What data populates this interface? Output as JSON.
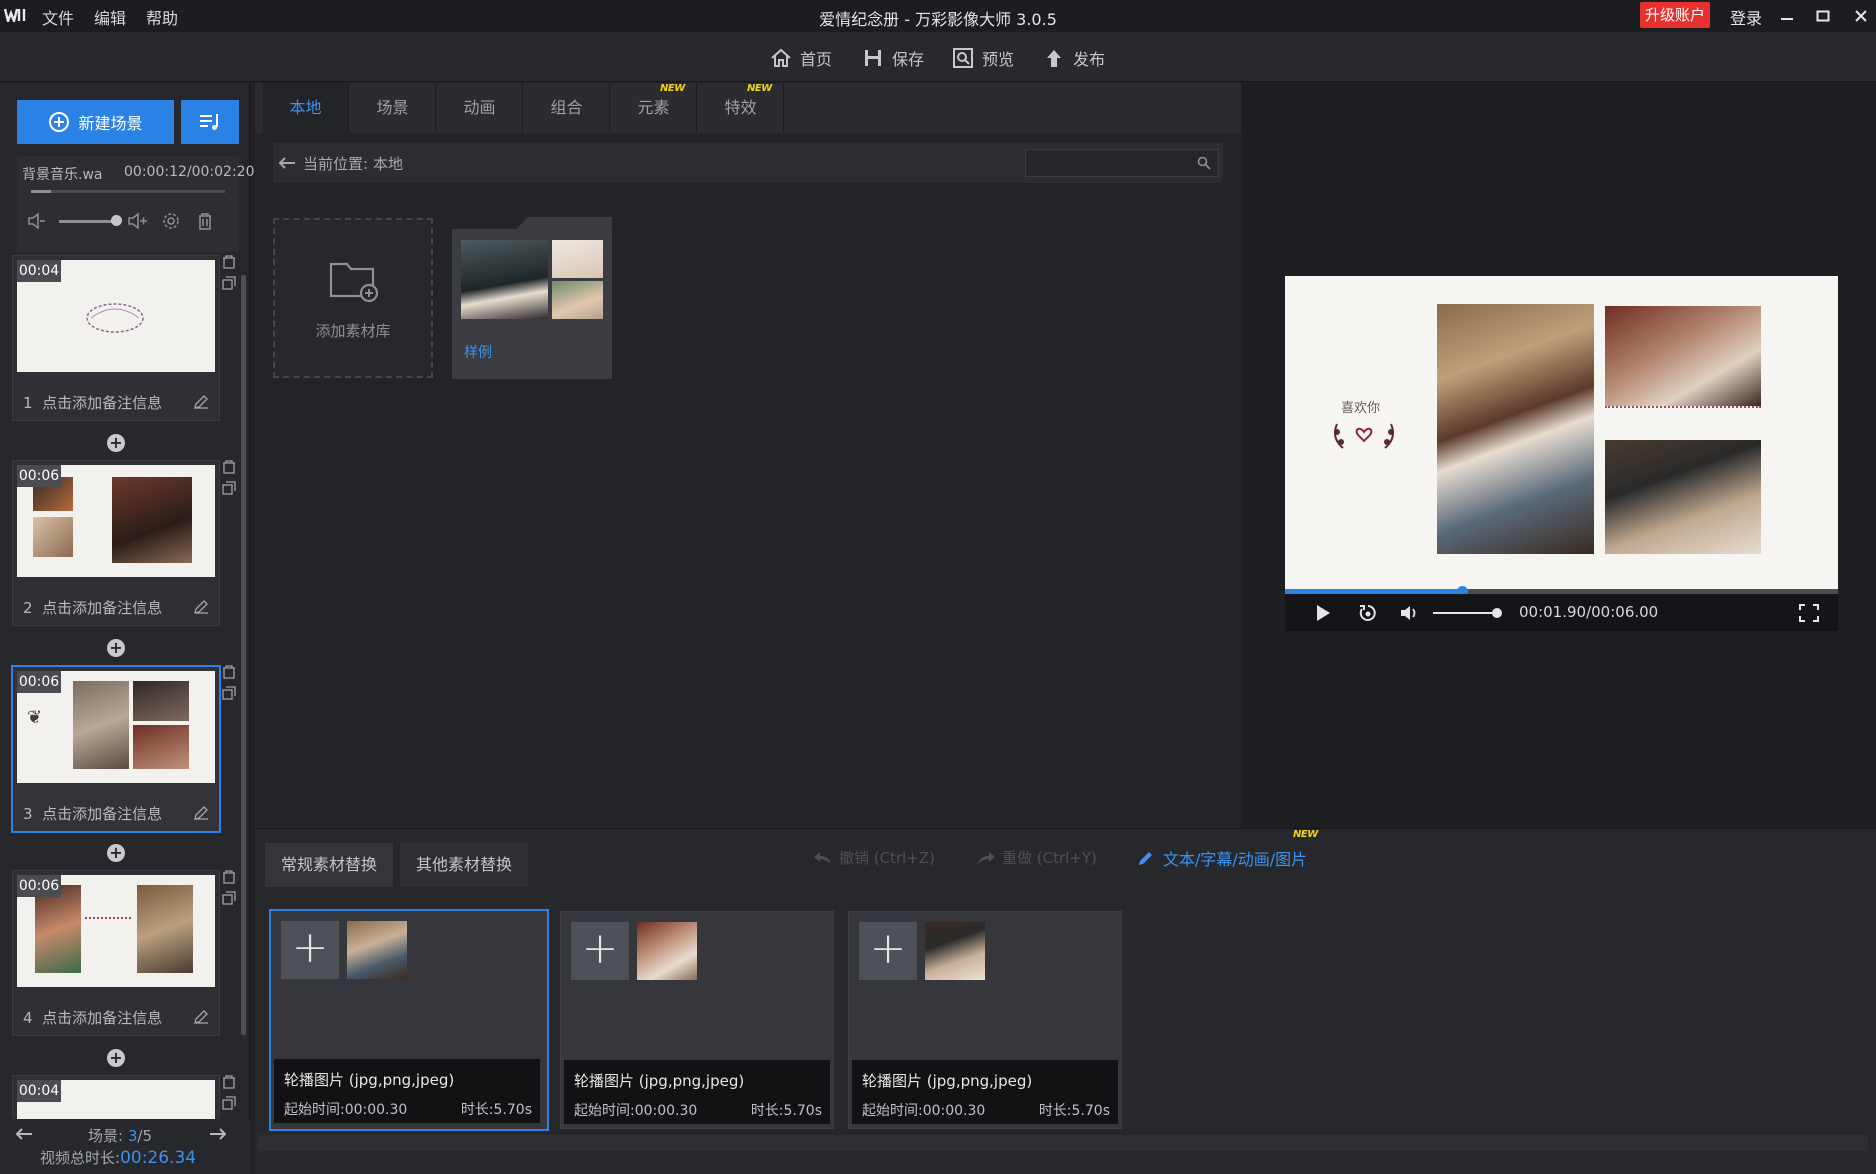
{
  "app": {
    "title": "爱情纪念册 - 万彩影像大师 3.0.5",
    "menu": [
      "文件",
      "编辑",
      "帮助"
    ],
    "upgrade_label": "升级账户",
    "login_label": "登录"
  },
  "toolbar": {
    "home": "首页",
    "save": "保存",
    "preview": "预览",
    "publish": "发布"
  },
  "left_panel": {
    "new_scene_label": "新建场景",
    "music": {
      "file": "背景音乐.wa",
      "time": "00:00:12/00:02:20",
      "volume_fraction": 0.75
    },
    "scenes": [
      {
        "duration": "00:04",
        "index": "1",
        "note": "点击添加备注信息"
      },
      {
        "duration": "00:06",
        "index": "2",
        "note": "点击添加备注信息"
      },
      {
        "duration": "00:06",
        "index": "3",
        "note": "点击添加备注信息"
      },
      {
        "duration": "00:06",
        "index": "4",
        "note": "点击添加备注信息"
      },
      {
        "duration": "00:04"
      }
    ],
    "pager": {
      "label": "场景:",
      "current": "3",
      "sep": "/",
      "total": "5"
    },
    "total": {
      "label": "视频总时长:",
      "value": "00:26.34"
    }
  },
  "library": {
    "tabs": [
      "本地",
      "场景",
      "动画",
      "组合",
      "元素",
      "特效"
    ],
    "active_tab": 0,
    "new_badge": "NEW",
    "path_label": "当前位置:",
    "path_value": "本地",
    "search_placeholder": "",
    "add_library_label": "添加素材库",
    "folder_label": "样例"
  },
  "preview": {
    "heart_text": "喜欢你",
    "time": "00:01.90/00:06.00",
    "progress_fraction": 0.32,
    "volume_fraction": 0.9
  },
  "bottom": {
    "tabs": [
      "常规素材替换",
      "其他素材替换"
    ],
    "undo": "撤销 (Ctrl+Z)",
    "redo": "重做 (Ctrl+Y)",
    "text_edit": "文本/字幕/动画/图片",
    "new_badge": "NEW",
    "cards": [
      {
        "title": "轮播图片 (jpg,png,jpeg)",
        "start": "起始时间:00:00.30",
        "duration": "时长:5.70s"
      },
      {
        "title": "轮播图片 (jpg,png,jpeg)",
        "start": "起始时间:00:00.30",
        "duration": "时长:5.70s"
      },
      {
        "title": "轮播图片 (jpg,png,jpeg)",
        "start": "起始时间:00:00.30",
        "duration": "时长:5.70s"
      }
    ]
  },
  "colors": {
    "accent": "#2a82e4",
    "upgrade": "#e8312f",
    "new_badge": "#f4d21a"
  }
}
